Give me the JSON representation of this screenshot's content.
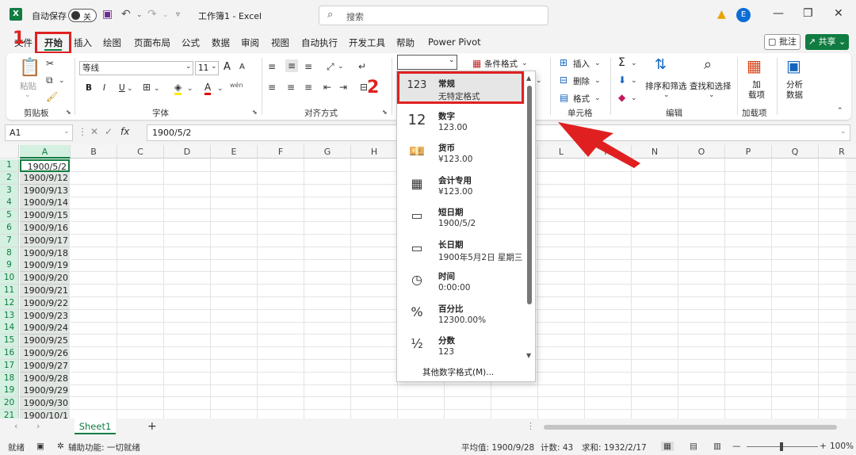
{
  "titlebar": {
    "autosave_label": "自动保存",
    "toggle_state": "关",
    "doc_title": "工作簿1  -  Excel",
    "search_placeholder": "搜索",
    "avatar_initial": "E"
  },
  "tabs": [
    "文件",
    "开始",
    "插入",
    "绘图",
    "页面布局",
    "公式",
    "数据",
    "审阅",
    "视图",
    "自动执行",
    "开发工具",
    "帮助",
    "Power Pivot"
  ],
  "tabs_right": {
    "comment": "批注",
    "share": "共享"
  },
  "markers": {
    "one": "1",
    "two": "2"
  },
  "ribbon": {
    "clipboard": {
      "paste": "粘贴",
      "label": "剪贴板"
    },
    "font": {
      "name": "等线",
      "size": "11",
      "label": "字体",
      "bold": "B",
      "italic": "I",
      "underline": "U",
      "grow": "A",
      "shrink": "A",
      "phonetic": "wén"
    },
    "alignment": {
      "label": "对齐方式"
    },
    "styles": {
      "conditional": "条件格式"
    },
    "cells": {
      "insert": "插入",
      "delete": "删除",
      "format": "格式",
      "label": "单元格"
    },
    "editing": {
      "sum": "Σ",
      "sort": "排序和筛选",
      "find": "查找和选择",
      "label": "编辑"
    },
    "addins": {
      "addins": "加\n载项",
      "label": "加载项"
    },
    "analyze": {
      "label": "分析\n数据"
    }
  },
  "formula_bar": {
    "namebox": "A1",
    "fx": "fx",
    "value": "1900/5/2"
  },
  "columns": [
    "A",
    "B",
    "C",
    "D",
    "E",
    "F",
    "G",
    "H",
    "I",
    "J",
    "K",
    "L",
    "M",
    "N",
    "O",
    "P",
    "Q",
    "R"
  ],
  "rows": [
    "1",
    "2",
    "3",
    "4",
    "5",
    "6",
    "7",
    "8",
    "9",
    "10",
    "11",
    "12",
    "13",
    "14",
    "15",
    "16",
    "17",
    "18",
    "19",
    "20",
    "21"
  ],
  "cells_a": [
    "1900/5/2",
    "1900/9/12",
    "1900/9/13",
    "1900/9/14",
    "1900/9/15",
    "1900/9/16",
    "1900/9/17",
    "1900/9/18",
    "1900/9/19",
    "1900/9/20",
    "1900/9/21",
    "1900/9/22",
    "1900/9/23",
    "1900/9/24",
    "1900/9/25",
    "1900/9/26",
    "1900/9/27",
    "1900/9/28",
    "1900/9/29",
    "1900/9/30",
    "1900/10/1"
  ],
  "number_format_menu": {
    "items": [
      {
        "name": "常规",
        "sample": "无特定格式",
        "icon": "clock-123-icon"
      },
      {
        "name": "数字",
        "sample": "123.00",
        "icon": "number-12-icon"
      },
      {
        "name": "货币",
        "sample": "¥123.00",
        "icon": "currency-icon"
      },
      {
        "name": "会计专用",
        "sample": "¥123.00",
        "icon": "accounting-icon"
      },
      {
        "name": "短日期",
        "sample": "1900/5/2",
        "icon": "calendar-icon"
      },
      {
        "name": "长日期",
        "sample": "1900年5月2日 星期三",
        "icon": "calendar-icon"
      },
      {
        "name": "时间",
        "sample": "0:00:00",
        "icon": "clock-icon"
      },
      {
        "name": "百分比",
        "sample": "12300.00%",
        "icon": "percent-icon"
      },
      {
        "name": "分数",
        "sample": "123",
        "icon": "fraction-icon"
      }
    ],
    "more": "其他数字格式(M)...",
    "glyph_123": "123",
    "glyph_12": "12",
    "glyph_percent": "%",
    "glyph_half": "½"
  },
  "sheet": {
    "name": "Sheet1",
    "add": "+"
  },
  "status": {
    "ready": "就绪",
    "accessibility": "辅助功能: 一切就绪",
    "average": "平均值: 1900/9/28",
    "count": "计数: 43",
    "sum": "求和: 1932/2/17",
    "zoom": "100%"
  },
  "colors": {
    "excel_green": "#107c41",
    "annotation_red": "#e02020"
  }
}
